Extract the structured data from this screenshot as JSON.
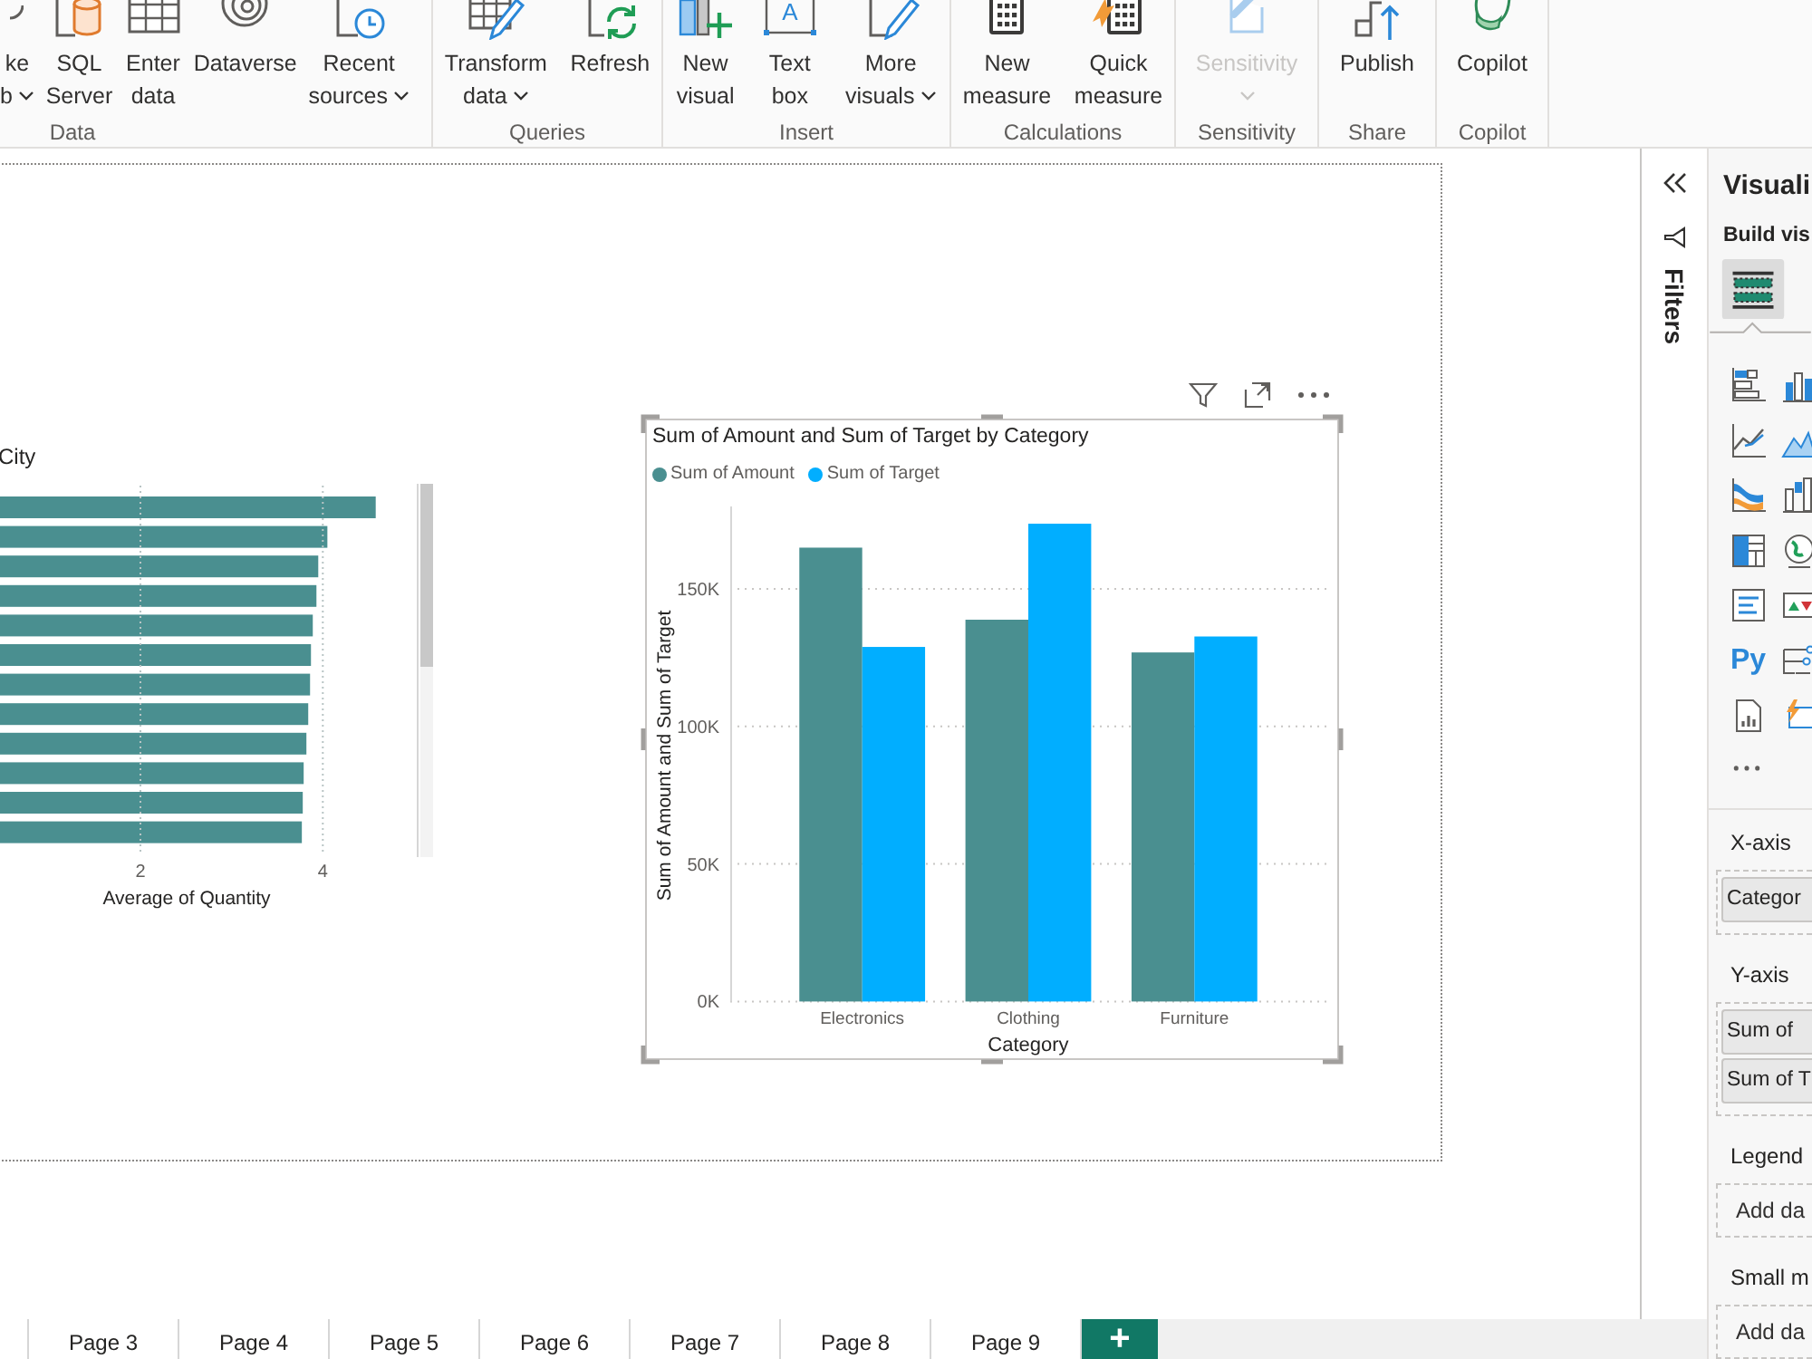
{
  "ribbon": {
    "groups": [
      {
        "label": "Data",
        "buttons": [
          {
            "lines": [
              "ke",
              "b"
            ],
            "dropdown": true,
            "disabled": false
          },
          {
            "lines": [
              "SQL",
              "Server"
            ],
            "dropdown": false,
            "disabled": false
          },
          {
            "lines": [
              "Enter",
              "data"
            ],
            "dropdown": false,
            "disabled": false
          },
          {
            "lines": [
              "Dataverse"
            ],
            "dropdown": false,
            "disabled": false
          },
          {
            "lines": [
              "Recent",
              "sources"
            ],
            "dropdown": true,
            "disabled": false
          }
        ]
      },
      {
        "label": "Queries",
        "buttons": [
          {
            "lines": [
              "Transform",
              "data"
            ],
            "dropdown": true,
            "disabled": false
          },
          {
            "lines": [
              "Refresh"
            ],
            "dropdown": false,
            "disabled": false
          }
        ]
      },
      {
        "label": "Insert",
        "buttons": [
          {
            "lines": [
              "New",
              "visual"
            ],
            "dropdown": false,
            "disabled": false
          },
          {
            "lines": [
              "Text",
              "box"
            ],
            "icon_letter": "A",
            "dropdown": false,
            "disabled": false
          },
          {
            "lines": [
              "More",
              "visuals"
            ],
            "dropdown": true,
            "disabled": false
          }
        ]
      },
      {
        "label": "Calculations",
        "buttons": [
          {
            "lines": [
              "New",
              "measure"
            ],
            "dropdown": false,
            "disabled": false
          },
          {
            "lines": [
              "Quick",
              "measure"
            ],
            "dropdown": false,
            "disabled": false
          }
        ]
      },
      {
        "label": "Sensitivity",
        "buttons": [
          {
            "lines": [
              "Sensitivity"
            ],
            "dropdown": true,
            "disabled": true
          }
        ]
      },
      {
        "label": "Share",
        "buttons": [
          {
            "lines": [
              "Publish"
            ],
            "dropdown": false,
            "disabled": false
          }
        ]
      },
      {
        "label": "Copilot",
        "buttons": [
          {
            "lines": [
              "Copilot"
            ],
            "dropdown": false,
            "disabled": false
          }
        ]
      }
    ]
  },
  "report_page": {
    "visuals": [
      {
        "selected": false,
        "chart_data": {
          "type": "bar",
          "orientation": "horizontal",
          "title": "City",
          "xlabel": "Average of Quantity",
          "categories": [
            null,
            null,
            null,
            null,
            null,
            null,
            null,
            null,
            null,
            null,
            null,
            null
          ],
          "values": [
            4.58,
            4.05,
            3.95,
            3.93,
            3.89,
            3.87,
            3.86,
            3.84,
            3.82,
            3.79,
            3.78,
            3.77
          ],
          "color": "#4a8f90",
          "xlim": [
            0.46,
            5.05
          ],
          "xticks": [
            2,
            4
          ],
          "grid": true
        }
      },
      {
        "selected": true,
        "chart_data": {
          "type": "bar",
          "title": "Sum of Amount and Sum of Target by Category",
          "xlabel": "Category",
          "ylabel": "Sum of Amount and Sum of Target",
          "categories": [
            "Electronics",
            "Clothing",
            "Furniture"
          ],
          "series": [
            {
              "name": "Sum of Amount",
              "color": "#4a8f90",
              "values": [
                165000,
                138800,
                126900
              ]
            },
            {
              "name": "Sum of Target",
              "color": "#01aeff",
              "values": [
                128900,
                173700,
                132700
              ]
            }
          ],
          "ylim": [
            0,
            180000
          ],
          "yticks": [
            {
              "value": 0,
              "label": "0K"
            },
            {
              "value": 50000,
              "label": "50K"
            },
            {
              "value": 100000,
              "label": "100K"
            },
            {
              "value": 150000,
              "label": "150K"
            }
          ],
          "legend": "top",
          "grid": true
        }
      }
    ]
  },
  "filters_pane": {
    "title": "Filters"
  },
  "visualizations_pane": {
    "title": "Visuali",
    "section": "Build vis",
    "python_label": "Py",
    "wells": [
      {
        "label": "X-axis",
        "fields": [
          "Categor"
        ]
      },
      {
        "label": "Y-axis",
        "fields": [
          "Sum of",
          "Sum of T"
        ]
      },
      {
        "label": "Legend",
        "placeholder": "Add da"
      },
      {
        "label": "Small m",
        "placeholder": "Add da"
      }
    ]
  },
  "page_tabs": [
    {
      "label": "Page 3",
      "selected": false
    },
    {
      "label": "Page 4",
      "selected": false
    },
    {
      "label": "Page 5",
      "selected": false
    },
    {
      "label": "Page 6",
      "selected": false
    },
    {
      "label": "Page 7",
      "selected": false
    },
    {
      "label": "Page 8",
      "selected": false
    },
    {
      "label": "Page 9",
      "selected": false
    }
  ],
  "add_page": "+"
}
